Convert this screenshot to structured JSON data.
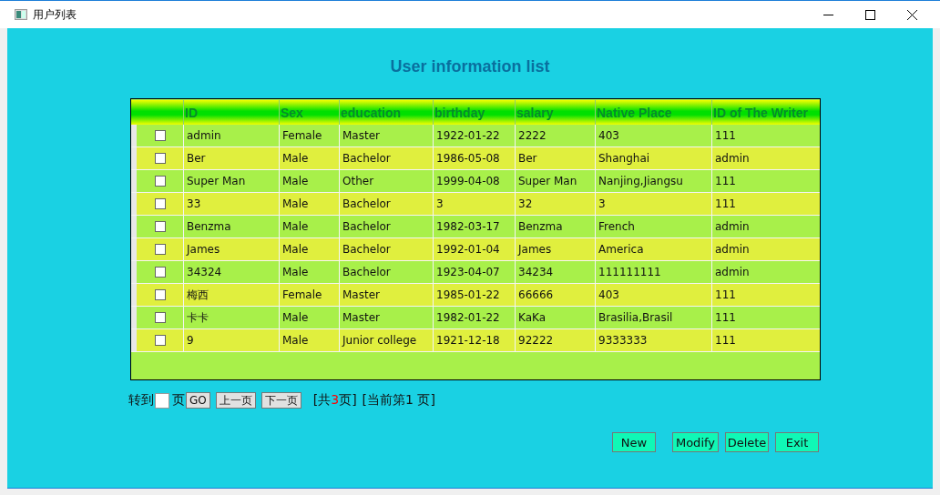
{
  "window": {
    "title": "用户列表"
  },
  "heading": "User information list",
  "table": {
    "columns": [
      "ID",
      "Sex",
      "education",
      "birthday",
      "salary",
      "Native Place",
      "ID of The Writer"
    ],
    "rows": [
      {
        "checked": false,
        "cells": [
          "admin",
          "Female",
          "Master",
          "1922-01-22",
          "2222",
          "403",
          "111"
        ]
      },
      {
        "checked": false,
        "cells": [
          "Ber",
          "Male",
          "Bachelor",
          "1986-05-08",
          "Ber",
          "Shanghai",
          "admin"
        ]
      },
      {
        "checked": false,
        "cells": [
          "Super Man",
          "Male",
          "Other",
          "1999-04-08",
          "Super Man",
          "Nanjing,Jiangsu",
          "111"
        ]
      },
      {
        "checked": false,
        "cells": [
          "33",
          "Male",
          "Bachelor",
          "3",
          "32",
          "3",
          "111"
        ]
      },
      {
        "checked": false,
        "cells": [
          "Benzma",
          "Male",
          "Bachelor",
          "1982-03-17",
          "Benzma",
          "French",
          "admin"
        ]
      },
      {
        "checked": false,
        "cells": [
          "James",
          "Male",
          "Bachelor",
          "1992-01-04",
          "James",
          "America",
          "admin"
        ]
      },
      {
        "checked": false,
        "cells": [
          "34324",
          "Male",
          "Bachelor",
          "1923-04-07",
          "34234",
          "111111111",
          "admin"
        ]
      },
      {
        "checked": false,
        "cells": [
          "梅西",
          "Female",
          "Master",
          "1985-01-22",
          "66666",
          "403",
          "111"
        ]
      },
      {
        "checked": false,
        "cells": [
          "卡卡",
          "Male",
          "Master",
          "1982-01-22",
          "KaKa",
          "Brasilia,Brasil",
          "111"
        ]
      },
      {
        "checked": false,
        "cells": [
          "9",
          "Male",
          "Junior college",
          "1921-12-18",
          "92222",
          "9333333",
          "111"
        ]
      }
    ]
  },
  "pager": {
    "goto_label": "转到",
    "page_label": "页",
    "go_button": "GO",
    "prev_button": "上一页",
    "next_button": "下一页",
    "total_prefix": "[共",
    "total_pages": "3",
    "total_suffix": "页]",
    "current": "[当前第1 页]"
  },
  "actions": [
    "New",
    "Modify",
    "Delete",
    "Exit"
  ]
}
